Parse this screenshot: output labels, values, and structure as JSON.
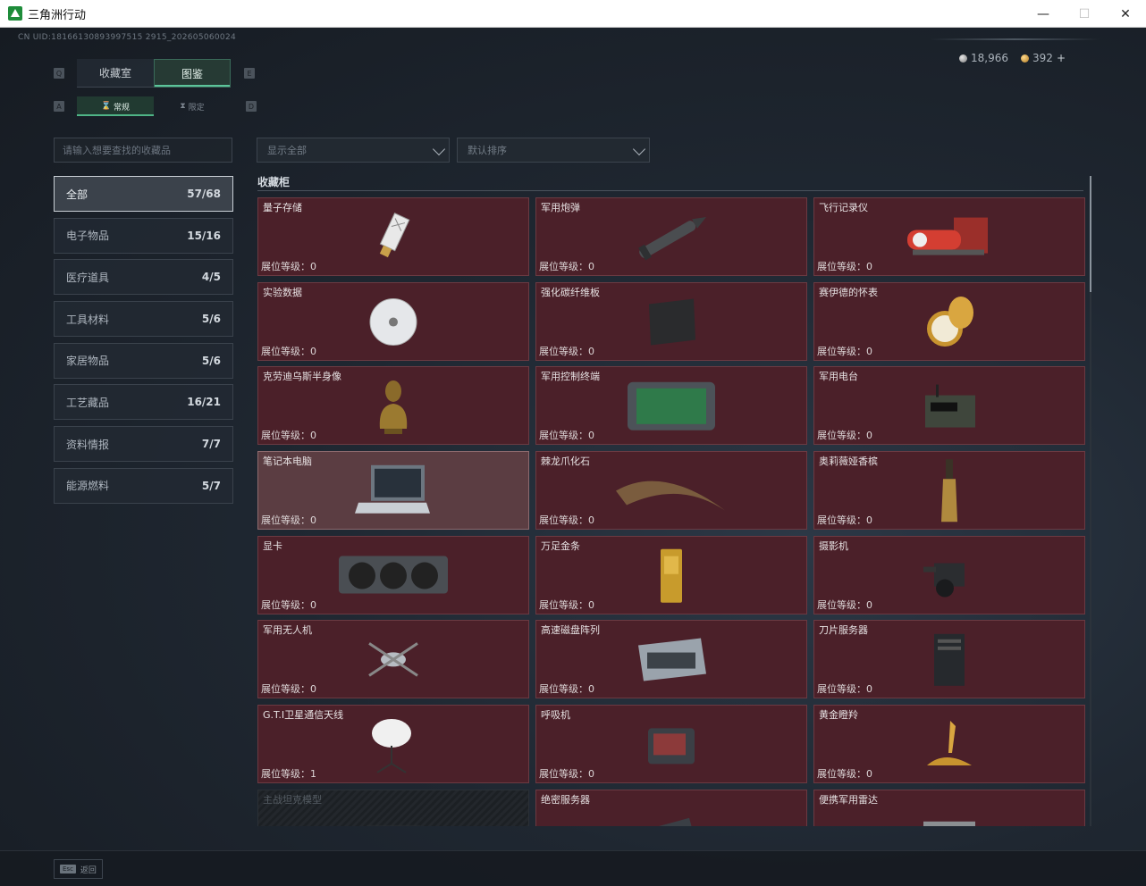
{
  "window": {
    "title": "三角洲行动",
    "minimize": "—",
    "maximize": "☐",
    "close": "✕"
  },
  "header": {
    "uid": "CN UID:18166130893997515 2915_202605060024",
    "silver": "18,966",
    "gold": "392",
    "plus": "+"
  },
  "tabs": {
    "collection_room": "收藏室",
    "catalog": "图鉴",
    "hint_left": "Q",
    "hint_right": "E"
  },
  "subtabs": {
    "normal": "常规",
    "limited": "限定",
    "hint_left": "A",
    "hint_right": "D"
  },
  "search": {
    "placeholder": "请输入想要查找的收藏品"
  },
  "filters": {
    "show": "显示全部",
    "sort": "默认排序"
  },
  "categories": [
    {
      "label": "全部",
      "count": "57/68"
    },
    {
      "label": "电子物品",
      "count": "15/16"
    },
    {
      "label": "医疗道具",
      "count": "4/5"
    },
    {
      "label": "工具材料",
      "count": "5/6"
    },
    {
      "label": "家居物品",
      "count": "5/6"
    },
    {
      "label": "工艺藏品",
      "count": "16/21"
    },
    {
      "label": "资料情报",
      "count": "7/7"
    },
    {
      "label": "能源燃料",
      "count": "5/7"
    }
  ],
  "section_title": "收藏柜",
  "level_prefix": "展位等级：",
  "items": [
    {
      "name": "量子存储",
      "level": "0",
      "icon": "usb-drive-icon"
    },
    {
      "name": "军用炮弹",
      "level": "0",
      "icon": "artillery-shell-icon"
    },
    {
      "name": "飞行记录仪",
      "level": "0",
      "icon": "flight-recorder-icon"
    },
    {
      "name": "实验数据",
      "level": "0",
      "icon": "disc-icon"
    },
    {
      "name": "强化碳纤维板",
      "level": "0",
      "icon": "carbon-plate-icon"
    },
    {
      "name": "赛伊德的怀表",
      "level": "0",
      "icon": "pocket-watch-icon"
    },
    {
      "name": "克劳迪乌斯半身像",
      "level": "0",
      "icon": "bust-icon"
    },
    {
      "name": "军用控制终端",
      "level": "0",
      "icon": "control-terminal-icon"
    },
    {
      "name": "军用电台",
      "level": "0",
      "icon": "radio-icon"
    },
    {
      "name": "笔记本电脑",
      "level": "0",
      "icon": "laptop-icon"
    },
    {
      "name": "棘龙爪化石",
      "level": "0",
      "icon": "claw-fossil-icon"
    },
    {
      "name": "奥莉薇娅香槟",
      "level": "0",
      "icon": "champagne-icon"
    },
    {
      "name": "显卡",
      "level": "0",
      "icon": "graphics-card-icon"
    },
    {
      "name": "万足金条",
      "level": "0",
      "icon": "gold-bar-icon"
    },
    {
      "name": "摄影机",
      "level": "0",
      "icon": "camera-icon"
    },
    {
      "name": "军用无人机",
      "level": "0",
      "icon": "drone-icon"
    },
    {
      "name": "高速磁盘阵列",
      "level": "0",
      "icon": "disk-array-icon"
    },
    {
      "name": "刀片服务器",
      "level": "0",
      "icon": "blade-server-icon"
    },
    {
      "name": "G.T.I卫星通信天线",
      "level": "1",
      "icon": "satellite-dish-icon"
    },
    {
      "name": "呼吸机",
      "level": "0",
      "icon": "ventilator-icon"
    },
    {
      "name": "黄金瞪羚",
      "level": "0",
      "icon": "gold-gazelle-icon"
    },
    {
      "name": "主战坦克模型",
      "level": "",
      "icon": "tank-model-icon"
    },
    {
      "name": "绝密服务器",
      "level": "",
      "icon": "server-icon"
    },
    {
      "name": "便携军用雷达",
      "level": "",
      "icon": "radar-icon"
    }
  ],
  "footer": {
    "esc_key": "Esc",
    "back": "返回"
  }
}
